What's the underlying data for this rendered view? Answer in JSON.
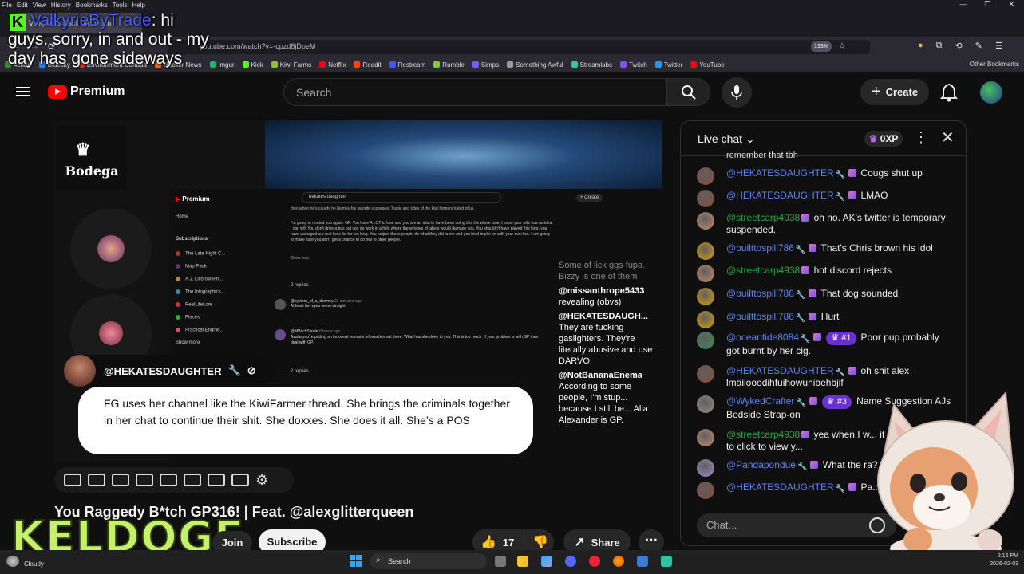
{
  "browser": {
    "menu": [
      "File",
      "Edit",
      "View",
      "History",
      "Bookmarks",
      "Tools",
      "Help"
    ],
    "tab_title": "Valkyrie is Back on Twitch",
    "url": "youtube.com/watch?v=-cpzd8jDpeM",
    "zoom": "133%",
    "bookmarks": [
      {
        "label": "4chan",
        "color": "#2f8f2f"
      },
      {
        "label": "Bluesky",
        "color": "#1e8cff"
      },
      {
        "label": "Environment Canada",
        "color": "#d52b1e"
      },
      {
        "label": "Hacker News",
        "color": "#ff6600"
      },
      {
        "label": "imgur",
        "color": "#1bb76e"
      },
      {
        "label": "Kick",
        "color": "#53fc18"
      },
      {
        "label": "Kiwi Farms",
        "color": "#8bbf3f"
      },
      {
        "label": "Netflix",
        "color": "#e50914"
      },
      {
        "label": "Reddit",
        "color": "#ff4500"
      },
      {
        "label": "Restream",
        "color": "#3b5bdb"
      },
      {
        "label": "Rumble",
        "color": "#85c742"
      },
      {
        "label": "Simps",
        "color": "#7a5af8"
      },
      {
        "label": "Something Awful",
        "color": "#999999"
      },
      {
        "label": "Streamlabs",
        "color": "#31c3a2"
      },
      {
        "label": "Twitch",
        "color": "#9146ff"
      },
      {
        "label": "Twitter",
        "color": "#1d9bf0"
      },
      {
        "label": "YouTube",
        "color": "#ff0000"
      }
    ],
    "other_bookmarks": "Other Bookmarks"
  },
  "overlay": {
    "kick_username": "ValkyrieByTrade",
    "message_start": ": hi",
    "message_rest": "guys. sorry, in and out - my day has gone sideways",
    "keldoge": "KELDOGE"
  },
  "youtube": {
    "logo_text": "Premium",
    "search_placeholder": "Search",
    "create_label": "Create",
    "video": {
      "bodega_label": "Bodega",
      "commenter_name": "@HEKATESDAUGHTER",
      "comment_text": "FG uses her channel like the KiwiFarmer thread. She brings the criminals together in her chat to continue their shit. She doxxes. She does it all. She’s a POS",
      "inner": {
        "logo": "Premium",
        "search": "hekates daughter",
        "create": "+ Create",
        "side_items": [
          "Home",
          "Subscriptions",
          "The Late Night C...",
          "Map Pack",
          "A.J. Lillbrowsen...",
          "The Infographics...",
          "RealLifeLore",
          "Places",
          "Practical Engine...",
          "Show more"
        ],
        "top_text": "then when he's caught he blames his favorite scapegoat Tragic and rides of the kiwi farmers hated of us.",
        "reply_text": "I'm going to remind you again. GP. You have A LOT to lose and you are an idiot to have been doing this the whole time. I know your wife has no idea. I can tell. You don't drive a bus but you do work in a field where these types of labels would damage you. You shouldn't have played this long, you have damaged our real lives for far too long. You helped those people do what they did to me and you tried to pile on with your own lies. I am going to make sure you don't get a chance to do this to other people.",
        "show_less": "Show less",
        "replies_1": "2 replies",
        "c1_user": "@system_of_a_downey",
        "c1_time": "22 minutes ago",
        "c1_text": "At least her eyes seem straight",
        "c2_user": "@MBitchSlante",
        "c2_time": "6 hours ago",
        "c2_text": "Azalia you're putting an innocent womans information out there. What has she done to you. This is too much. If your problem is with GP then deal with GP.",
        "replies_2": "2 replies",
        "reply_label": "Reply"
      },
      "chat_overlay": [
        {
          "user": "",
          "text": "Some of lick ggs fupa. Bizzy is one of them"
        },
        {
          "user": "@missanthrope5433",
          "text": "revealing (obvs)"
        },
        {
          "user": "@HEKATESDAUGH...",
          "text": "They are fucking gaslighters. They're literally abusive and use DARVO."
        },
        {
          "user": "@NotBananaEnema",
          "text": "According to some people, I'm stup... because I still be... Alia Alexander is GP."
        }
      ]
    },
    "title": "You Raggedy B*tch  GP316! | Feat. @alexglitterqueen",
    "join_label": "Join",
    "subscribe_label": "Subscribe",
    "like_count": "17",
    "share_label": "Share"
  },
  "chat": {
    "title": "Live chat",
    "xp": "0XP",
    "top_fragment": "remember that tbh",
    "messages": [
      {
        "user": "@HEKATESDAUGHTER",
        "color": "b",
        "rank": "",
        "text": "Cougs shut up",
        "avatar": "#8a4a3a"
      },
      {
        "user": "@HEKATESDAUGHTER",
        "color": "b",
        "rank": "",
        "text": "LMAO",
        "avatar": "#8a4a3a"
      },
      {
        "user": "@streetcarp4938",
        "color": "g",
        "rank": "",
        "text": "oh no. AK's twitter is temporary suspended.",
        "avatar": "#c58a6a"
      },
      {
        "user": "@builttospill786",
        "color": "b",
        "rank": "",
        "text": "That's Chris brown his idol",
        "avatar": "#d8a200"
      },
      {
        "user": "@streetcarp4938",
        "color": "g",
        "rank": "",
        "text": "hot discord rejects",
        "avatar": "#c58a6a"
      },
      {
        "user": "@builttospill786",
        "color": "b",
        "rank": "",
        "text": "That dog sounded",
        "avatar": "#d8a200"
      },
      {
        "user": "@builttospill786",
        "color": "b",
        "rank": "",
        "text": "Hurt",
        "avatar": "#d8a200"
      },
      {
        "user": "@oceantide8084",
        "color": "b",
        "rank": "#1",
        "text": "Poor pup probably got burnt by her cig.",
        "avatar": "#3a8a5a"
      },
      {
        "user": "@HEKATESDAUGHTER",
        "color": "b",
        "rank": "",
        "text": "oh shit alex lmaiiooodihfuihowuhibehbjif",
        "avatar": "#8a4a3a"
      },
      {
        "user": "@WykedCrafter",
        "color": "b",
        "rank": "#3",
        "text": "Name Suggestion AJs Bedside Strap-on",
        "avatar": "#9a8a8a"
      },
      {
        "user": "@streetcarp4938",
        "color": "g",
        "rank": "",
        "text": "yea when I w... it was and i had to click to view y...",
        "avatar": "#c58a6a"
      },
      {
        "user": "@Pandapondue",
        "color": "b",
        "rank": "",
        "text": "What the ra?",
        "avatar": "#a08ad0"
      },
      {
        "user": "@HEKATESDAUGHTER",
        "color": "b",
        "rank": "",
        "text": "Pa...",
        "avatar": "#8a4a3a"
      }
    ],
    "input_placeholder": "Chat..."
  },
  "taskbar": {
    "weather": "Cloudy",
    "search": "Search",
    "time": "2:16 PM",
    "date": "2026-02-03"
  }
}
